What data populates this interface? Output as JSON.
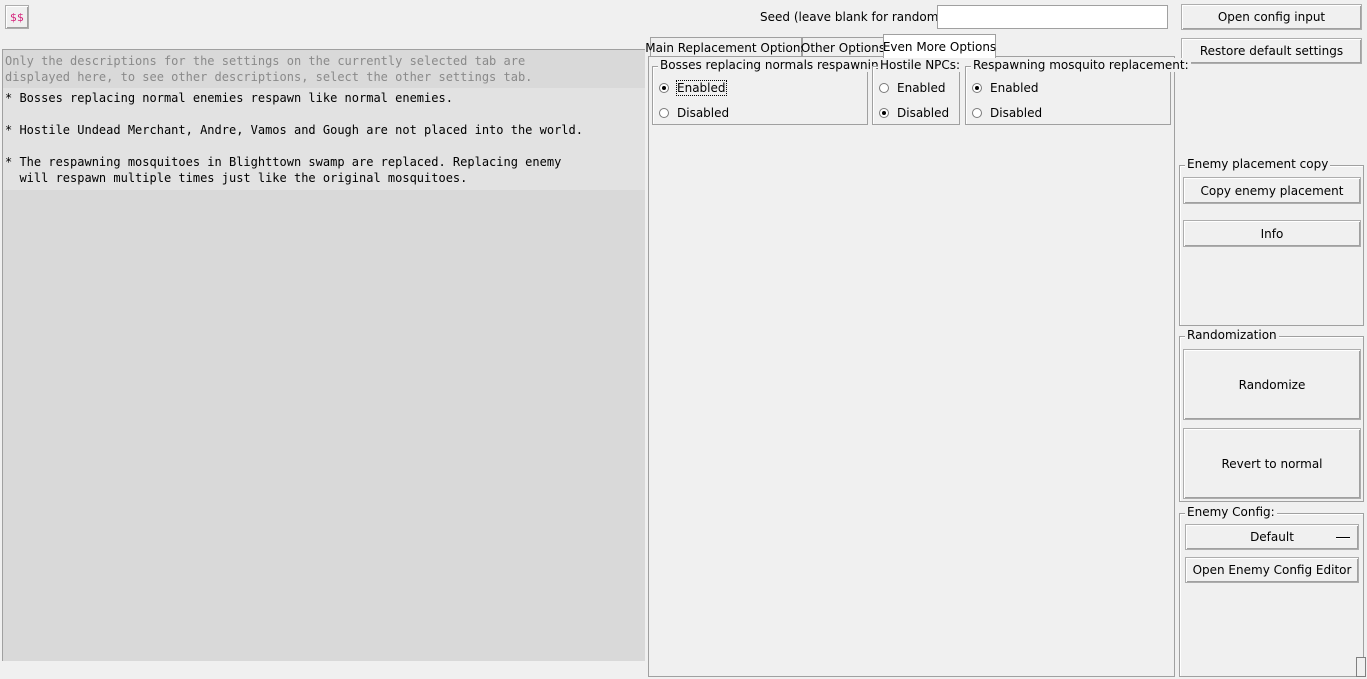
{
  "app_icon": {
    "glyph": "$$",
    "color": "#d4237a"
  },
  "seed": {
    "label": "Seed (leave blank for random):",
    "value": ""
  },
  "buttons": {
    "open_config": "Open config input",
    "restore_defaults": "Restore default settings",
    "copy_enemy_placement": "Copy enemy placement",
    "info": "Info",
    "randomize": "Randomize",
    "revert": "Revert to normal",
    "open_enemy_config_editor": "Open Enemy Config Editor"
  },
  "description": {
    "intro_line1": "Only the descriptions for the settings on the currently selected tab are",
    "intro_line2": "displayed here, to see other descriptions, select the other settings tab.",
    "item1": "* Bosses replacing normal enemies respawn like normal enemies.",
    "item2": "* Hostile Undead Merchant, Andre, Vamos and Gough are not placed into the world.",
    "item3_line1": "* The respawning mosquitoes in Blighttown swamp are replaced. Replacing enemy",
    "item3_line2": "  will respawn multiple times just like the original mosquitoes."
  },
  "tabs": [
    {
      "label": "Main Replacement Options",
      "active": false
    },
    {
      "label": "Other Options",
      "active": false
    },
    {
      "label": "Even More Options",
      "active": true
    }
  ],
  "option_groups": [
    {
      "title": "Bosses replacing normals respawning:",
      "options": [
        "Enabled",
        "Disabled"
      ],
      "selected": "Enabled"
    },
    {
      "title": "Hostile NPCs:",
      "options": [
        "Enabled",
        "Disabled"
      ],
      "selected": "Disabled"
    },
    {
      "title": "Respawning mosquito replacement:",
      "options": [
        "Enabled",
        "Disabled"
      ],
      "selected": "Enabled"
    }
  ],
  "sections": {
    "enemy_placement_copy": "Enemy placement copy",
    "randomization": "Randomization",
    "enemy_config": "Enemy Config:"
  },
  "enemy_config": {
    "selected": "Default"
  }
}
